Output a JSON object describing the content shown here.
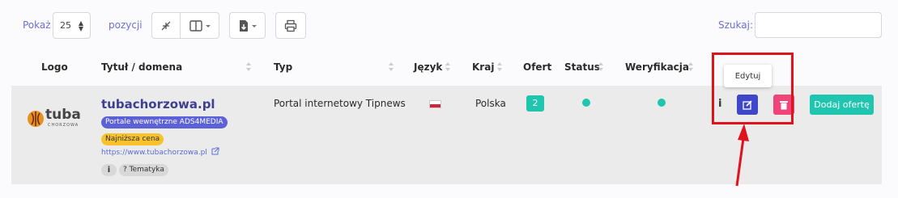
{
  "toolbar": {
    "show_label": "Pokaż",
    "page_size": "25",
    "entries_label": "pozycji",
    "search_label": "Szukaj:",
    "search_value": ""
  },
  "table": {
    "headers": [
      "Logo",
      "Tytuł / domena",
      "Typ",
      "Język",
      "Kraj",
      "Ofert",
      "Status",
      "Weryfikacja"
    ]
  },
  "row": {
    "logo_text": "tuba",
    "logo_subtext": "CHORZOWA",
    "domain": "tubachorzowa.pl",
    "badge_portal": "Portale wewnętrzne ADS4MEDIA",
    "badge_price": "Najniższa cena",
    "url": "https://www.tubachorzowa.pl",
    "tag_info": "i",
    "tag_topic": "? Tematyka",
    "type": "Portal internetowy Tipnews",
    "country": "Polska",
    "offers": "2",
    "info_label": "i",
    "add_offer_label": "Dodaj ofertę"
  },
  "tooltip": {
    "edit_label": "Edytuj"
  },
  "colors": {
    "accent": "#6c6fd6",
    "edit": "#3f46c9",
    "delete": "#f0457a",
    "add_offer": "#20c5b0",
    "status": "#20c5b0",
    "highlight": "#e0121b"
  }
}
